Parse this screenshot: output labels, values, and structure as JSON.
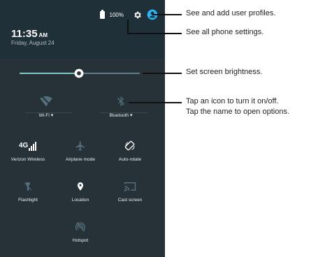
{
  "status_bar": {
    "battery": "100%",
    "icons": [
      "battery-icon",
      "gear-icon",
      "account-icon"
    ]
  },
  "header": {
    "time": "11:35",
    "ampm": "AM",
    "date": "Friday, August 24"
  },
  "brightness": {
    "level": 0.5
  },
  "quick_settings": {
    "wifi": "Wi-Fi",
    "bluetooth": "Bluetooth",
    "tiles": [
      {
        "label": "Verizon Wireless",
        "icon": "network-4g-icon"
      },
      {
        "label": "Airplane mode",
        "icon": "airplane-icon"
      },
      {
        "label": "Auto-rotate",
        "icon": "rotate-icon"
      },
      {
        "label": "Flashlight",
        "icon": "flashlight-icon"
      },
      {
        "label": "Location",
        "icon": "location-icon"
      },
      {
        "label": "Cast screen",
        "icon": "cast-icon"
      },
      {
        "label": "Hotspot",
        "icon": "hotspot-icon"
      }
    ]
  },
  "callouts": {
    "profiles": "See and add user profiles.",
    "settings": "See all phone settings.",
    "brightness": "Set screen brightness.",
    "icons_1": "Tap an icon to turn it on/off.",
    "icons_2": "Tap the name to open options."
  },
  "colors": {
    "panel": "#263238",
    "accent": "#80cbc4",
    "profile": "#29b6f6"
  }
}
